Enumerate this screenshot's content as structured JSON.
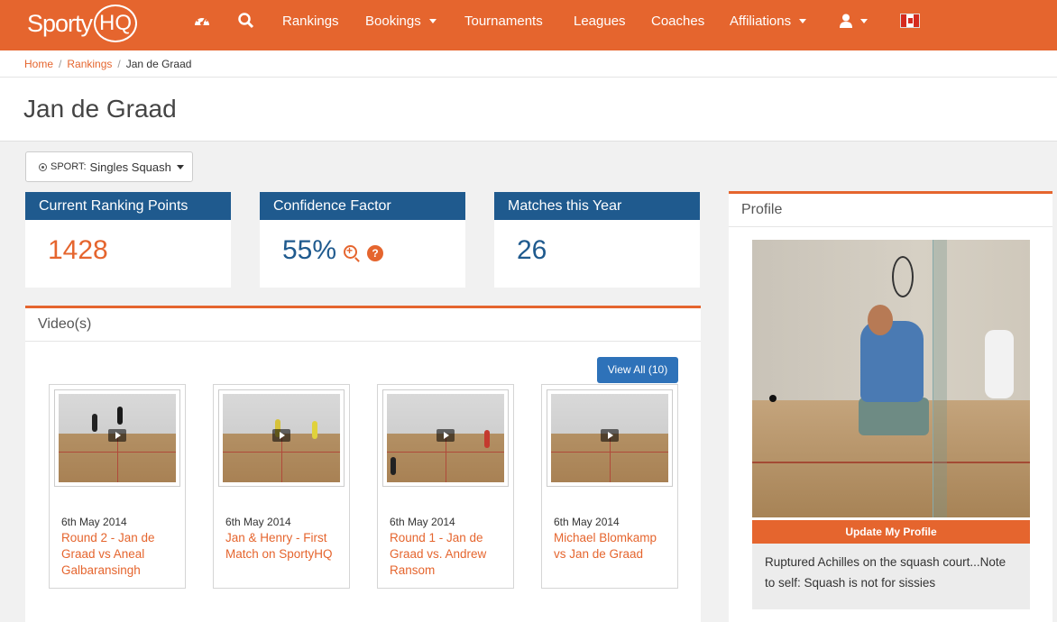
{
  "nav": {
    "logo_sporty": "Sporty",
    "logo_hq": "HQ",
    "items": [
      "Rankings",
      "Bookings",
      "Tournaments",
      "Leagues",
      "Coaches",
      "Affiliations"
    ]
  },
  "breadcrumb": {
    "home": "Home",
    "rankings": "Rankings",
    "current": "Jan de Graad",
    "separator": "/"
  },
  "page_title": "Jan de Graad",
  "sport": {
    "prefix": "SPORT:",
    "value": "Singles Squash"
  },
  "stats": [
    {
      "label": "Current Ranking Points",
      "value": "1428"
    },
    {
      "label": "Confidence Factor",
      "value": "55%"
    },
    {
      "label": "Matches this Year",
      "value": "26"
    }
  ],
  "videos": {
    "heading": "Video(s)",
    "view_all": "View All (10)",
    "items": [
      {
        "date": "6th May 2014",
        "title": "Round 2 - Jan de Graad vs Aneal Galbaransingh"
      },
      {
        "date": "6th May 2014",
        "title": "Jan & Henry - First Match on SportyHQ"
      },
      {
        "date": "6th May 2014",
        "title": "Round 1 - Jan de Graad vs. Andrew Ransom"
      },
      {
        "date": "6th May 2014",
        "title": "Michael Blomkamp vs Jan de Graad"
      }
    ]
  },
  "profile": {
    "heading": "Profile",
    "update_button": "Update My Profile",
    "description": "Ruptured Achilles on the squash court...Note to self: Squash is not for sissies"
  },
  "colors": {
    "brand_orange": "#e5652e",
    "stat_blue": "#1f5a8e",
    "button_blue": "#2e72b9"
  },
  "icons": [
    "dashboard-icon",
    "search-icon",
    "user-icon",
    "canada-flag-icon",
    "zoom-in-icon",
    "help-icon",
    "play-icon"
  ]
}
